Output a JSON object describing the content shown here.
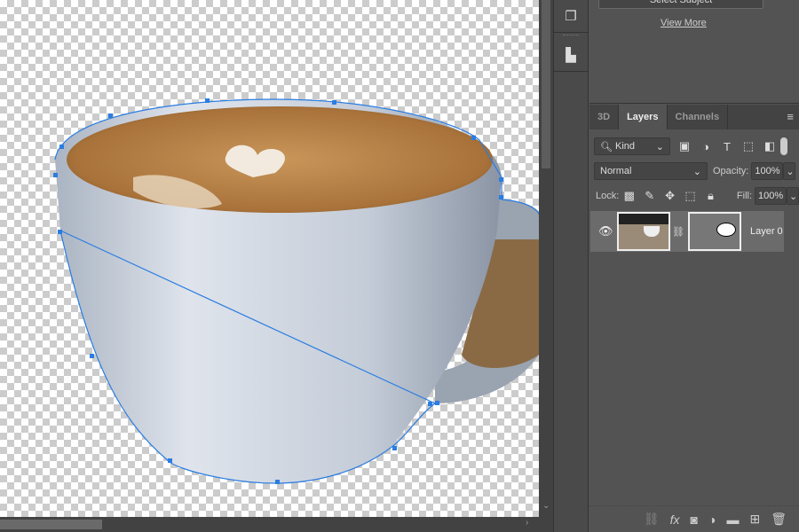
{
  "top_panel": {
    "select_subject": "Select Subject",
    "view_more": "View More"
  },
  "tabs": [
    {
      "label": "3D"
    },
    {
      "label": "Layers"
    },
    {
      "label": "Channels"
    }
  ],
  "filter": {
    "kind": "Kind"
  },
  "blend": {
    "mode": "Normal",
    "opacity_label": "Opacity:",
    "opacity": "100%",
    "lock_label": "Lock:",
    "fill_label": "Fill:",
    "fill": "100%"
  },
  "layers": [
    {
      "name": "Layer 0",
      "visible": true
    }
  ],
  "colors": {
    "path": "#2a7de1",
    "panel": "#535353",
    "selected_layer": "#6b6b6b"
  }
}
